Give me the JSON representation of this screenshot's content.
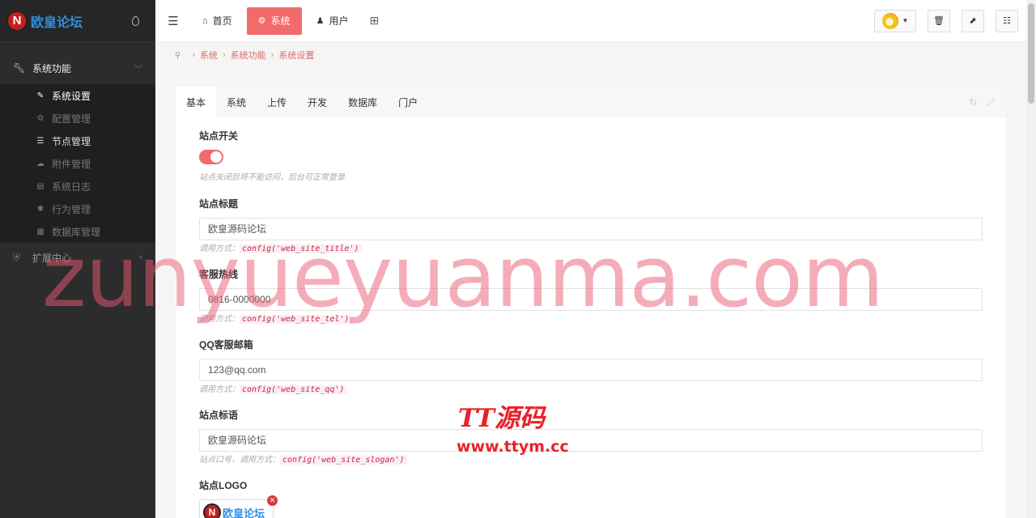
{
  "brand": {
    "name": "欧皇论坛",
    "logo_letter": "N"
  },
  "sidebar": {
    "group_main": {
      "label": "系统功能"
    },
    "items": [
      {
        "label": "系统设置",
        "icon": "wrench-icon",
        "glyph": "✎"
      },
      {
        "label": "配置管理",
        "icon": "cogs-icon",
        "glyph": "⚙"
      },
      {
        "label": "节点管理",
        "icon": "list-icon",
        "glyph": "☰"
      },
      {
        "label": "附件管理",
        "icon": "cloud-icon",
        "glyph": "☁"
      },
      {
        "label": "系统日志",
        "icon": "book-icon",
        "glyph": "▤"
      },
      {
        "label": "行为管理",
        "icon": "bug-icon",
        "glyph": "✱"
      },
      {
        "label": "数据库管理",
        "icon": "database-icon",
        "glyph": "▦"
      }
    ],
    "group_ext": {
      "label": "扩展中心"
    }
  },
  "header": {
    "nav": [
      {
        "label": "首页",
        "icon": "home-icon",
        "glyph": "⌂"
      },
      {
        "label": "系统",
        "icon": "cog-icon",
        "glyph": "⚙"
      },
      {
        "label": "用户",
        "icon": "user-icon",
        "glyph": "♟"
      }
    ]
  },
  "breadcrumb": [
    "系统",
    "系统功能",
    "系统设置"
  ],
  "tabs": [
    "基本",
    "系统",
    "上传",
    "开发",
    "数据库",
    "门户"
  ],
  "form": {
    "site_switch": {
      "label": "站点开关",
      "help": "站点关闭后将不能访问，后台可正常登录",
      "value": "on"
    },
    "site_title": {
      "label": "站点标题",
      "value": "欧皇源码论坛",
      "help_prefix": "调用方式：",
      "help_code": "config('web_site_title')"
    },
    "site_tel": {
      "label": "客服热线",
      "value": "0816-0000000",
      "help_prefix": "调用方式：",
      "help_code": "config('web_site_tel')"
    },
    "site_qq": {
      "label": "QQ客服邮箱",
      "value": "123@qq.com",
      "help_prefix": "调用方式：",
      "help_code": "config('web_site_qq')"
    },
    "site_slogan": {
      "label": "站点标语",
      "value": "欧皇源码论坛",
      "help_prefix": "站点口号，调用方式：",
      "help_code": "config('web_site_slogan')"
    },
    "site_logo": {
      "label": "站点LOGO",
      "logo_text": "欧皇论坛",
      "logo_letter": "N"
    }
  },
  "watermarks": {
    "big": "zunyueyuanma.com",
    "brand": "TT源码",
    "url": "www.ttym.cc"
  },
  "colors": {
    "accent": "#f36a6a",
    "sidebar_bg": "#2c2c2c",
    "brand_blue": "#2f8fe0",
    "logo_red": "#c41f1f"
  }
}
